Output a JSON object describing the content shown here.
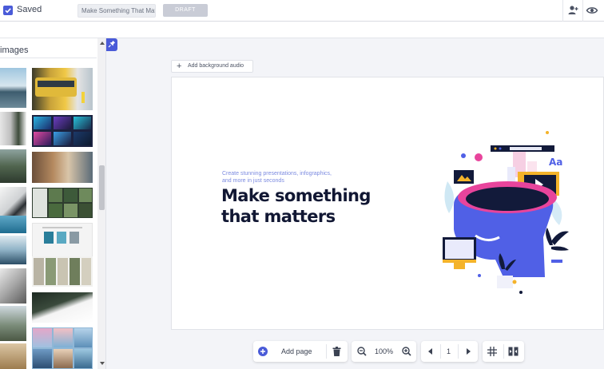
{
  "header": {
    "saved_label": "Saved",
    "title_value": "Make Something That Matt",
    "draft_label": "DRAFT",
    "icons": [
      "add-collaborator-icon",
      "preview-eye-icon"
    ]
  },
  "panel": {
    "title": "images"
  },
  "canvas": {
    "audio_label": "Add background audio",
    "slide": {
      "subtitle": "Create stunning presentations, infographics, and more in just seconds",
      "title": "Make something that matters",
      "badge_text": "Aa"
    }
  },
  "toolbar": {
    "add_page_label": "Add page",
    "zoom_value": "100%",
    "page_number": "1",
    "icons": [
      "add-page-icon",
      "trash-icon",
      "zoom-out-icon",
      "zoom-in-icon",
      "prev-page-icon",
      "next-page-icon",
      "grid-icon",
      "split-view-icon"
    ]
  },
  "colors": {
    "accent": "#4a5bd8",
    "title_dark": "#111733",
    "subtitle_blue": "#7c8be0",
    "illustration_pink": "#e8449c",
    "illustration_blue": "#5060e6",
    "illustration_yellow": "#f4b32a"
  }
}
